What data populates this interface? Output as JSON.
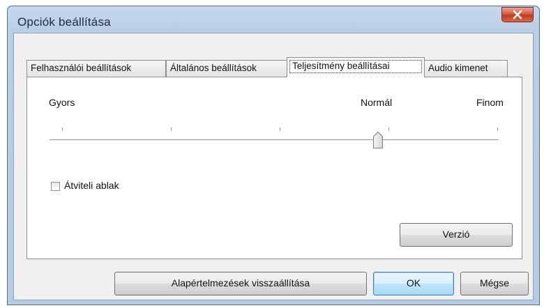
{
  "window": {
    "title": "Opciók beállítása"
  },
  "tabs": [
    {
      "label": "Felhasználói beállítások"
    },
    {
      "label": "Általános beállítások"
    },
    {
      "label": "Teljesítmény beállításai",
      "active": true
    },
    {
      "label": "Audio kimenet"
    }
  ],
  "performance": {
    "slider": {
      "labels": {
        "left": "Gyors",
        "middle": "Normál",
        "right": "Finom"
      },
      "tick_count": 5,
      "selected_tick": 4
    },
    "checkbox": {
      "label": "Átviteli ablak",
      "checked": false
    },
    "version_button": "Verzió"
  },
  "footer": {
    "reset_button": "Alapértelmezések visszaállítása",
    "ok_button": "OK",
    "cancel_button": "Mégse"
  },
  "icons": {
    "close": "close-icon",
    "slider_thumb": "slider-thumb"
  },
  "colors": {
    "titlebar": "#b8cde6",
    "close_button": "#c94a33",
    "default_button": "#3c7fb1"
  }
}
